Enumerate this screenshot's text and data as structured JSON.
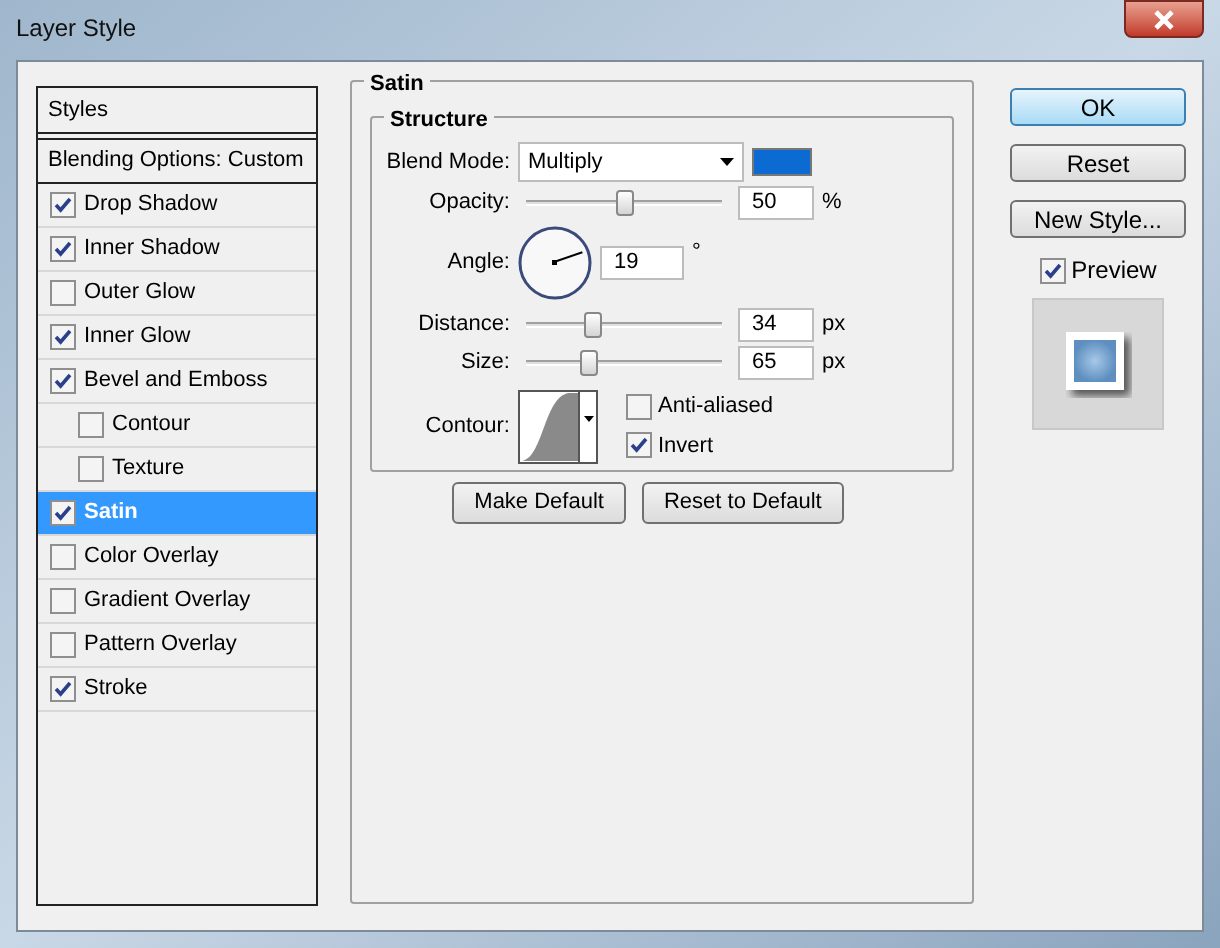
{
  "window": {
    "title": "Layer Style"
  },
  "sidebar": {
    "header": "Styles",
    "blending": "Blending Options: Custom",
    "items": [
      {
        "label": "Drop Shadow",
        "checked": true,
        "selected": false
      },
      {
        "label": "Inner Shadow",
        "checked": true,
        "selected": false
      },
      {
        "label": "Outer Glow",
        "checked": false,
        "selected": false
      },
      {
        "label": "Inner Glow",
        "checked": true,
        "selected": false
      },
      {
        "label": "Bevel and Emboss",
        "checked": true,
        "selected": false,
        "children": [
          {
            "label": "Contour",
            "checked": false,
            "selected": false
          },
          {
            "label": "Texture",
            "checked": false,
            "selected": false
          }
        ]
      },
      {
        "label": "Satin",
        "checked": true,
        "selected": true
      },
      {
        "label": "Color Overlay",
        "checked": false,
        "selected": false
      },
      {
        "label": "Gradient Overlay",
        "checked": false,
        "selected": false
      },
      {
        "label": "Pattern Overlay",
        "checked": false,
        "selected": false
      },
      {
        "label": "Stroke",
        "checked": true,
        "selected": false
      }
    ]
  },
  "panel": {
    "title": "Satin",
    "group": "Structure",
    "blend_mode": {
      "label": "Blend Mode:",
      "value": "Multiply",
      "color": "#0b6bd3"
    },
    "opacity": {
      "label": "Opacity:",
      "level": 0.5,
      "value": "50",
      "unit": "%"
    },
    "angle": {
      "label": "Angle:",
      "value": "19",
      "unit": "°"
    },
    "distance": {
      "label": "Distance:",
      "level": 0.34,
      "value": "34",
      "unit": "px"
    },
    "size": {
      "label": "Size:",
      "level": 0.32,
      "value": "65",
      "unit": "px"
    },
    "contour": {
      "label": "Contour:"
    },
    "options": [
      {
        "label": "Anti-aliased",
        "checked": false
      },
      {
        "label": "Invert",
        "checked": true
      }
    ],
    "buttons": [
      "Make Default",
      "Reset to Default"
    ]
  },
  "actions": [
    {
      "label": "OK",
      "default": true
    },
    {
      "label": "Reset",
      "default": false
    },
    {
      "label": "New Style...",
      "default": false
    }
  ],
  "preview": {
    "label": "Preview",
    "checked": true
  }
}
